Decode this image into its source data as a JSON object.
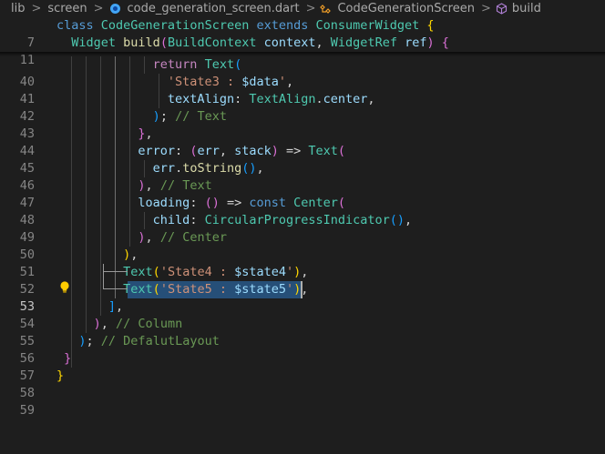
{
  "breadcrumb": {
    "items": [
      "lib",
      "screen",
      "code_generation_screen.dart",
      "CodeGenerationScreen",
      "build"
    ],
    "separator": ">",
    "icons": [
      "dart-file-icon",
      "class-symbol-icon",
      "method-symbol-icon"
    ]
  },
  "editor": {
    "active_line": 53,
    "colors": {
      "background": "#1e1e1e",
      "selection": "#264f78",
      "keyword": "#569cd6",
      "type": "#4ec9b0",
      "function": "#dcdcaa",
      "string": "#ce9178",
      "comment": "#6a9955"
    },
    "sticky_lines": [
      {
        "number": "7",
        "code": "class CodeGenerationScreen extends ConsumerWidget {"
      },
      {
        "number": "11",
        "code": "  Widget build(BuildContext context, WidgetRef ref) {"
      }
    ],
    "lines": [
      {
        "number": "40",
        "code": "              return Text("
      },
      {
        "number": "41",
        "code": "                'State3 : $data',"
      },
      {
        "number": "42",
        "code": "                textAlign: TextAlign.center,"
      },
      {
        "number": "43",
        "code": "              ); // Text"
      },
      {
        "number": "44",
        "code": "            },"
      },
      {
        "number": "45",
        "code": "            error: (err, stack) => Text("
      },
      {
        "number": "46",
        "code": "              err.toString(),"
      },
      {
        "number": "47",
        "code": "            ), // Text"
      },
      {
        "number": "48",
        "code": "            loading: () => const Center("
      },
      {
        "number": "49",
        "code": "              child: CircularProgressIndicator(),"
      },
      {
        "number": "50",
        "code": "            ), // Center"
      },
      {
        "number": "51",
        "code": "          ),"
      },
      {
        "number": "52",
        "code": "          Text('State4 : $state4'),"
      },
      {
        "number": "53",
        "code": "          Text('State5 : $state5'),"
      },
      {
        "number": "54",
        "code": "        ],"
      },
      {
        "number": "55",
        "code": "      ), // Column"
      },
      {
        "number": "56",
        "code": "    ); // DefalutLayout"
      },
      {
        "number": "57",
        "code": "  }"
      },
      {
        "number": "58",
        "code": "}"
      },
      {
        "number": "59",
        "code": ""
      }
    ]
  },
  "lightbulb": {
    "icon": "lightbulb-icon",
    "color": "#ffcc00"
  }
}
